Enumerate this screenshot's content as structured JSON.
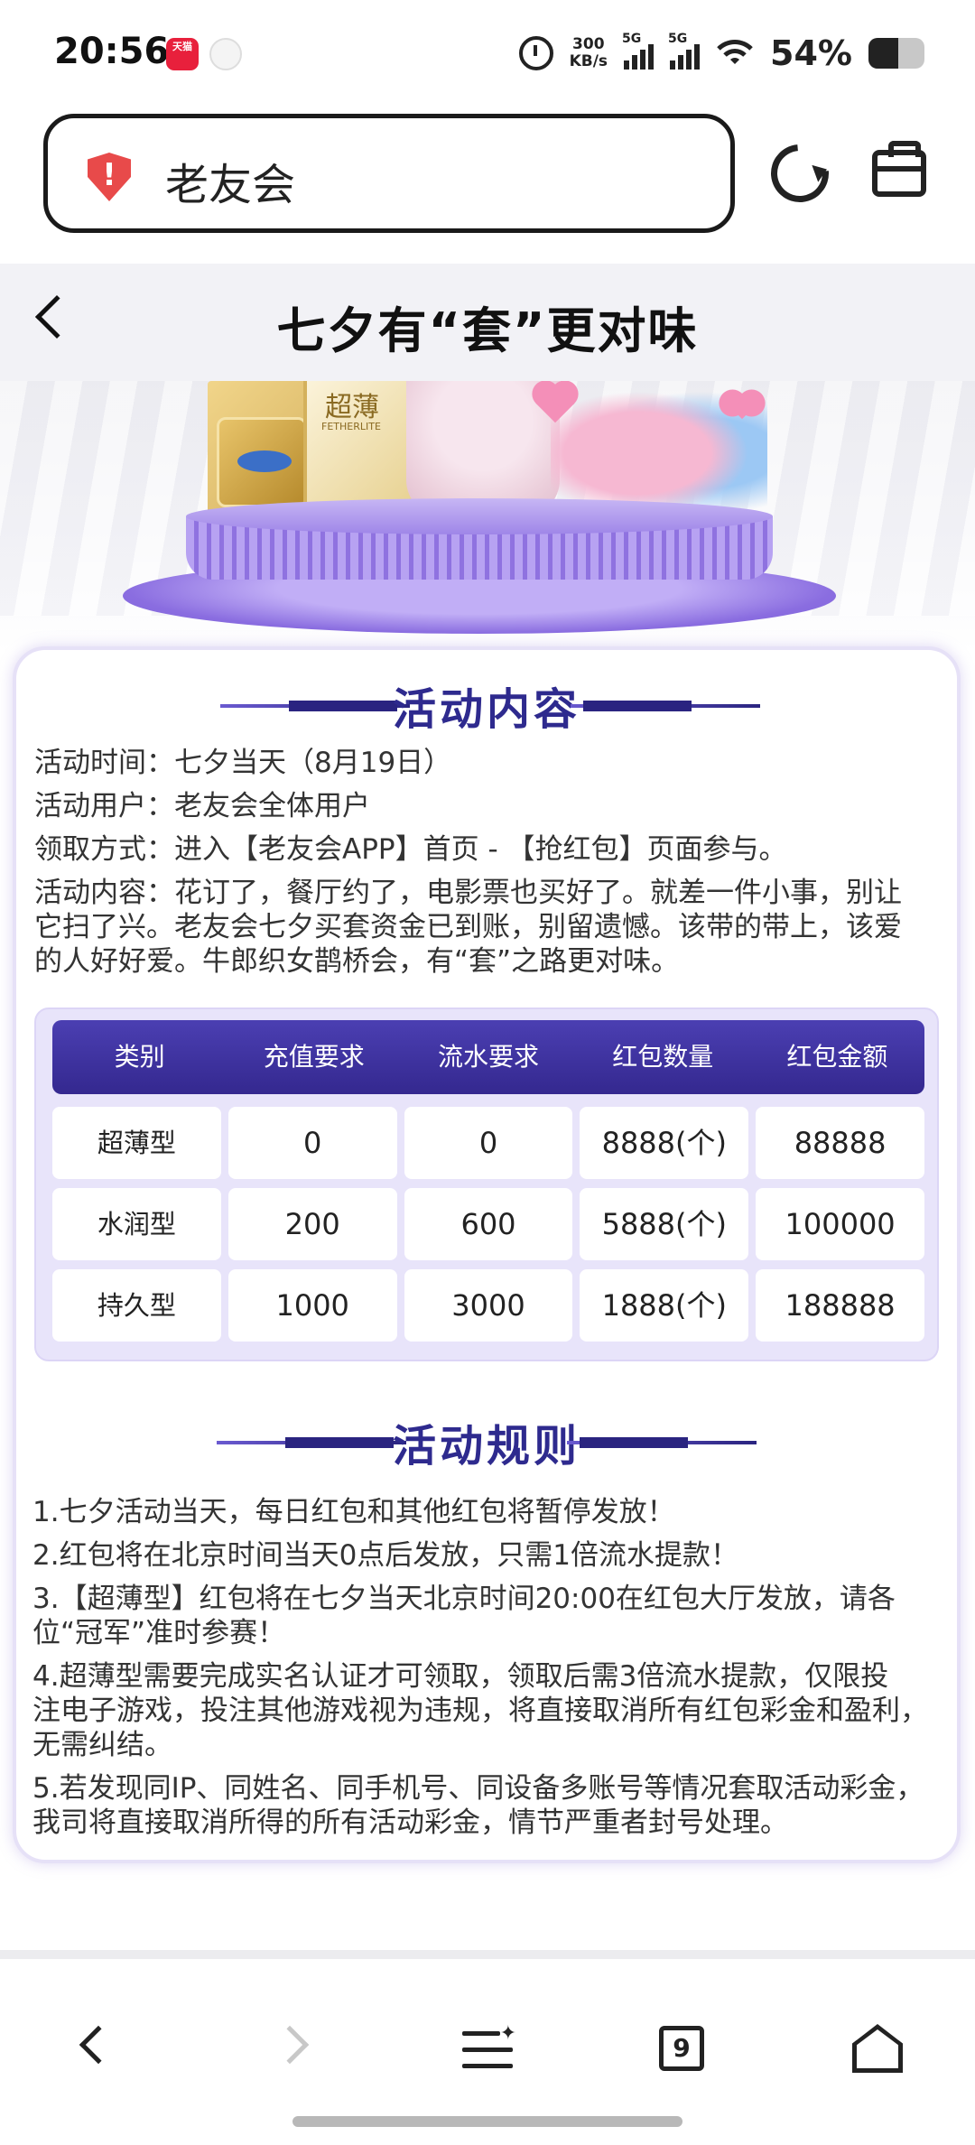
{
  "status_bar": {
    "time": "20:56",
    "notif_tmall": "天猫",
    "net_speed_value": "300",
    "net_speed_unit": "KB/s",
    "sim1": "5G",
    "sim2": "5G",
    "battery_percent_text": "54%",
    "battery_level": 0.54
  },
  "browser": {
    "url_text": "老友会"
  },
  "header": {
    "title": "七夕有“套”更对味"
  },
  "banner": {
    "box_text": "超薄",
    "box_subtext": "FETHERLITE"
  },
  "activity": {
    "heading": "活动内容",
    "lines": [
      "活动时间：七夕当天（8月19日）",
      "活动用户：老友会全体用户",
      "领取方式：进入【老友会APP】首页 - 【抢红包】页面参与。"
    ],
    "content_lines": [
      "活动内容：花订了，餐厅约了，电影票也买好了。就差一件小事，别让",
      "它扫了兴。老友会七夕买套资金已到账，别留遗憾。该带的带上，该爱",
      "的人好好爱。牛郎织女鹊桥会，有“套”之路更对味。"
    ]
  },
  "table": {
    "headers": [
      "类别",
      "充值要求",
      "流水要求",
      "红包数量",
      "红包金额"
    ],
    "rows": [
      [
        "超薄型",
        "0",
        "0",
        "8888(个)",
        "88888"
      ],
      [
        "水润型",
        "200",
        "600",
        "5888(个)",
        "100000"
      ],
      [
        "持久型",
        "1000",
        "3000",
        "1888(个)",
        "188888"
      ]
    ]
  },
  "rules": {
    "heading": "活动规则",
    "items": [
      [
        "1.七夕活动当天，每日红包和其他红包将暂停发放！"
      ],
      [
        "2.红包将在北京时间当天0点后发放，只需1倍流水提款！"
      ],
      [
        "3.【超薄型】红包将在七夕当天北京时间20:00在红包大厅发放，请各",
        "位“冠军”准时参赛！"
      ],
      [
        "4.超薄型需要完成实名认证才可领取，领取后需3倍流水提款，仅限投",
        "注电子游戏，投注其他游戏视为违规，将直接取消所有红包彩金和盈利，",
        "无需纠结。"
      ],
      [
        "5.若发现同IP、同姓名、同手机号、同设备多账号等情况套取活动彩金，",
        "我司将直接取消所得的所有活动彩金，情节严重者封号处理。"
      ]
    ]
  },
  "bottom_nav": {
    "tab_count": "9"
  },
  "colors": {
    "accent": "#2e2a8e",
    "table_header": "#3b2f9f",
    "podium": "#9f86e8",
    "shield": "#e84a4a"
  },
  "icons": [
    "shield-alert-icon",
    "reload-icon",
    "toolbox-icon",
    "back-chevron-icon",
    "nav-back-icon",
    "nav-forward-icon",
    "menu-icon",
    "tabs-icon",
    "home-icon"
  ]
}
